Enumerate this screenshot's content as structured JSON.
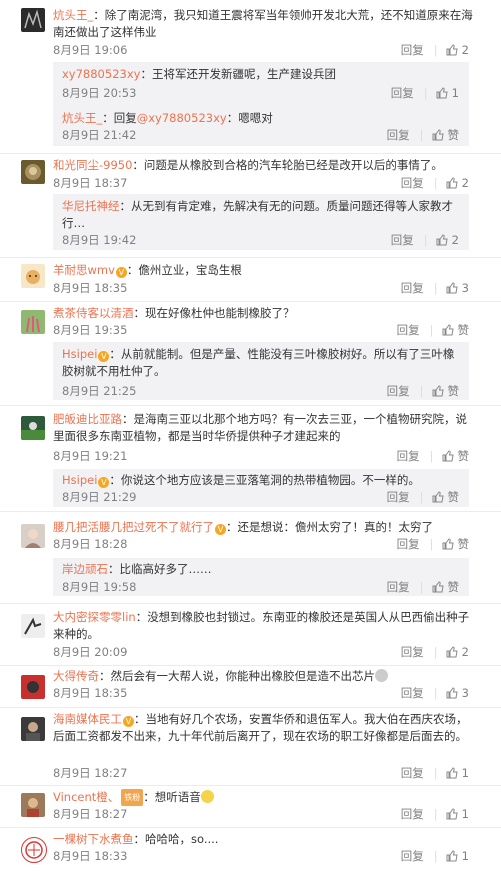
{
  "labels": {
    "reply": "回复",
    "like": "赞",
    "colon": "：",
    "reply_to_prefix": "回复"
  },
  "comments": [
    {
      "name": "炕头王_",
      "text": "除了南泥湾，我只知道王震将军当年领帅开发北大荒，还不知道原来在海南还做出了这样伟业",
      "time": "8月9日 19:06",
      "likes": "2"
    },
    {
      "name": "xy7880523xy",
      "text": "王将军还开发新疆呢，生产建设兵团",
      "time": "8月9日 20:53",
      "likes": "1"
    },
    {
      "name": "炕头王_",
      "reply_target": "@xy7880523xy",
      "text": "嗯嗯对",
      "time": "8月9日 21:42",
      "likes": "赞"
    },
    {
      "name": "和光同尘-9950",
      "text": "问题是从橡胶到合格的汽车轮胎已经是改开以后的事情了。",
      "time": "8月9日 18:37",
      "likes": "2"
    },
    {
      "name": "华尼托神经",
      "text": "从无到有肯定难，先解决有无的问题。质量问题还得等人家教才行…",
      "time": "8月9日 19:42",
      "likes": "2"
    },
    {
      "name": "羊耐思wmv",
      "text": "儋州立业，宝岛生根",
      "time": "8月9日 18:35",
      "likes": "3"
    },
    {
      "name": "煮茶侍客以清酒",
      "text": "现在好像杜仲也能制橡胶了？",
      "time": "8月9日 19:35",
      "likes": "赞"
    },
    {
      "name": "Hsipei",
      "text": "从前就能制。但是产量、性能没有三叶橡胶树好。所以有了三叶橡胶树就不用杜仲了。",
      "time": "8月9日 21:25",
      "likes": "赞"
    },
    {
      "name": "肥皈迪比亚路",
      "text": "是海南三亚以北那个地方吗？有一次去三亚，一个植物研究院，说里面很多东南亚植物，都是当时华侨提供种子才建起来的",
      "time": "8月9日 19:21",
      "likes": "赞"
    },
    {
      "name": "Hsipei",
      "text": "你说这个地方应该是三亚落笔洞的热带植物园。不一样的。",
      "time": "8月9日 21:29",
      "likes": "赞"
    },
    {
      "name": "腰几把活腰几把过死不了就行了",
      "text": "还是想说：儋州太穷了！真的！太穷了",
      "time": "8月9日 18:28",
      "likes": "赞"
    },
    {
      "name": "岸边顽石",
      "text": "比临高好多了……",
      "time": "8月9日 19:58",
      "likes": "赞"
    },
    {
      "name": "大内密探零零lin",
      "text": "没想到橡胶也封锁过。东南亚的橡胶还是英国人从巴西偷出种子来种的。",
      "time": "8月9日 20:09",
      "likes": "2"
    },
    {
      "name": "大得传奇",
      "text": "然后会有一大帮人说，你能种出橡胶但是造不出芯片",
      "time": "8月9日 18:35",
      "likes": "3"
    },
    {
      "name": "海南媒体民工",
      "text": "当地有好几个农场，安置华侨和退伍军人。我大伯在西庆农场，后面工资都发不出来，九十年代前后离开了，现在农场的职工好像都是后面去的。",
      "time": "8月9日 18:27",
      "likes": "1"
    },
    {
      "name": "Vincent橙、",
      "badge": "铁粉",
      "text": "想听语音",
      "time": "8月9日 18:27",
      "likes": "1"
    },
    {
      "name": "一棵树下水煮鱼",
      "text": "哈哈哈，so....",
      "time": "8月9日 18:33",
      "likes": "1"
    }
  ]
}
